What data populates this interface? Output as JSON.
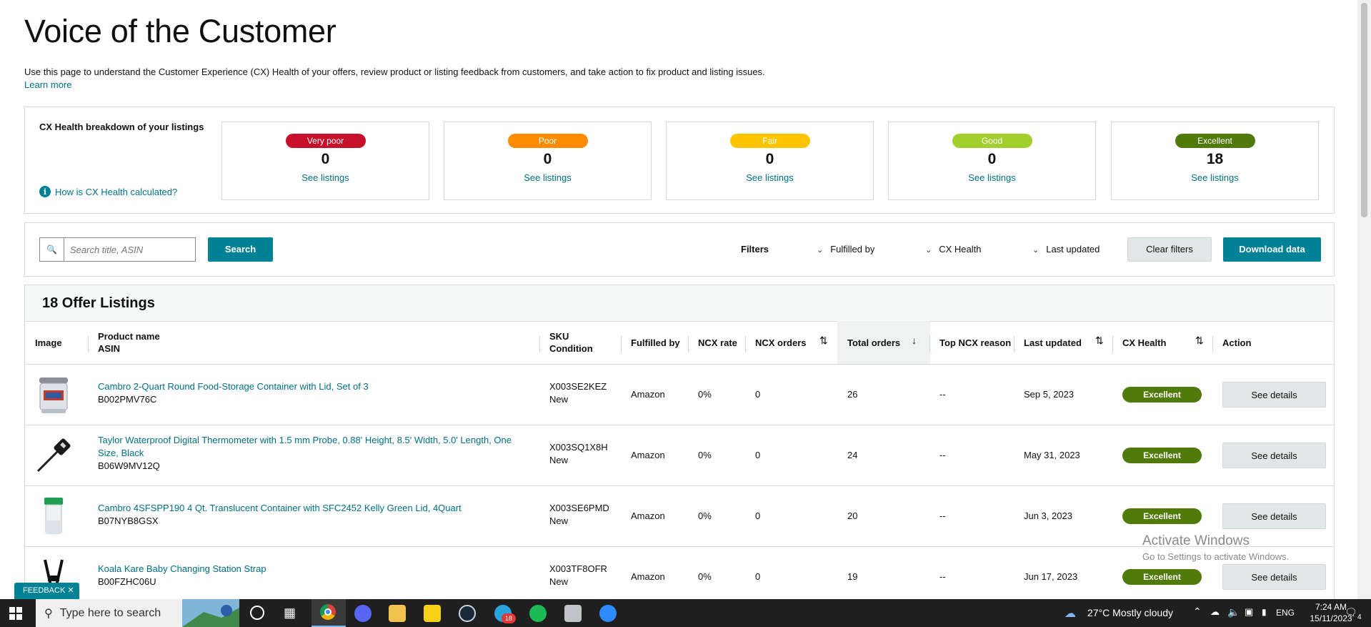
{
  "page": {
    "title": "Voice of the Customer",
    "intro": "Use this page to understand the Customer Experience (CX) Health of your offers, review product or listing feedback from customers, and take action to fix product and listing issues.",
    "learn_more": "Learn more"
  },
  "health": {
    "title": "CX Health breakdown of your listings",
    "help_link": "How is CX Health calculated?",
    "cards": [
      {
        "label": "Very poor",
        "count": "0",
        "link": "See listings",
        "color": "#c7102a"
      },
      {
        "label": "Poor",
        "count": "0",
        "link": "See listings",
        "color": "#ff8c00"
      },
      {
        "label": "Fair",
        "count": "0",
        "link": "See listings",
        "color": "#ffc400"
      },
      {
        "label": "Good",
        "count": "0",
        "link": "See listings",
        "color": "#a3cf2e"
      },
      {
        "label": "Excellent",
        "count": "18",
        "link": "See listings",
        "color": "#507a0a"
      }
    ]
  },
  "filters": {
    "search_placeholder": "Search title, ASIN",
    "search_button": "Search",
    "label": "Filters",
    "fulfilled_by": "Fulfilled by",
    "cx_health": "CX Health",
    "last_updated": "Last updated",
    "clear": "Clear filters",
    "download": "Download data"
  },
  "listings": {
    "title": "18 Offer Listings",
    "columns": {
      "image": "Image",
      "product": "Product name",
      "asin": "ASIN",
      "sku": "SKU",
      "condition": "Condition",
      "fulfilled": "Fulfilled by",
      "ncx_rate": "NCX rate",
      "ncx_orders": "NCX orders",
      "total_orders": "Total orders",
      "top_reason": "Top NCX reason",
      "last_updated": "Last updated",
      "cx_health": "CX Health",
      "action": "Action"
    },
    "rows": [
      {
        "name": "Cambro 2-Quart Round Food-Storage Container with Lid, Set of 3",
        "asin": "B002PMV76C",
        "sku": "X003SE2KEZ",
        "condition": "New",
        "fulfilled": "Amazon",
        "ncx_rate": "0%",
        "ncx_orders": "0",
        "total": "26",
        "reason": "--",
        "updated": "Sep 5, 2023",
        "health": "Excellent",
        "action": "See details"
      },
      {
        "name": "Taylor Waterproof Digital Thermometer with 1.5 mm Probe, 0.88' Height, 8.5' Width, 5.0' Length, One Size, Black",
        "asin": "B06W9MV12Q",
        "sku": "X003SQ1X8H",
        "condition": "New",
        "fulfilled": "Amazon",
        "ncx_rate": "0%",
        "ncx_orders": "0",
        "total": "24",
        "reason": "--",
        "updated": "May 31, 2023",
        "health": "Excellent",
        "action": "See details"
      },
      {
        "name": "Cambro 4SFSPP190 4 Qt. Translucent Container with SFC2452 Kelly Green Lid, 4Quart",
        "asin": "B07NYB8GSX",
        "sku": "X003SE6PMD",
        "condition": "New",
        "fulfilled": "Amazon",
        "ncx_rate": "0%",
        "ncx_orders": "0",
        "total": "20",
        "reason": "--",
        "updated": "Jun 3, 2023",
        "health": "Excellent",
        "action": "See details"
      },
      {
        "name": "Koala Kare Baby Changing Station Strap",
        "asin": "B00FZHC06U",
        "sku": "X003TF8OFR",
        "condition": "New",
        "fulfilled": "Amazon",
        "ncx_rate": "0%",
        "ncx_orders": "0",
        "total": "19",
        "reason": "--",
        "updated": "Jun 17, 2023",
        "health": "Excellent",
        "action": "See details"
      }
    ]
  },
  "windows": {
    "activate_title": "Activate Windows",
    "activate_sub": "Go to Settings to activate Windows."
  },
  "feedback": "FEEDBACK",
  "taskbar": {
    "search_placeholder": "Type here to search",
    "weather": "27°C  Mostly cloudy",
    "lang": "ENG",
    "time": "7:24 AM",
    "date": "15/11/2023",
    "badge": "18",
    "notif": "4"
  }
}
